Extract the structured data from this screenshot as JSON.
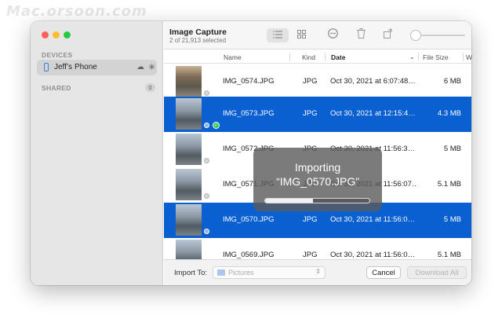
{
  "watermark": "Mac.orsoon.com",
  "sidebar": {
    "devices_heading": "DEVICES",
    "device_name": "Jeff’s Phone",
    "shared_heading": "SHARED",
    "shared_count": "0"
  },
  "toolbar": {
    "title": "Image Capture",
    "subtitle": "2 of 21,913 selected",
    "icons": [
      "list-view-icon",
      "grid-view-icon",
      "more-icon",
      "trash-icon",
      "rotate-icon",
      "thumbnail-size-slider"
    ]
  },
  "table": {
    "headers": {
      "name": "Name",
      "kind": "Kind",
      "date": "Date",
      "size": "File Size",
      "extra": "W"
    },
    "rows": [
      {
        "name": "IMG_0574.JPG",
        "kind": "JPG",
        "date": "Oct 30, 2021 at 6:07:48…",
        "size": "6 MB",
        "selected": false
      },
      {
        "name": "IMG_0573.JPG",
        "kind": "JPG",
        "date": "Oct 30, 2021 at 12:15:4…",
        "size": "4.3 MB",
        "selected": true
      },
      {
        "name": "IMG_0572.JPG",
        "kind": "JPG",
        "date": "Oct 30, 2021 at 11:56:3…",
        "size": "5 MB",
        "selected": false
      },
      {
        "name": "IMG_0571.JPG",
        "kind": "JPG",
        "date": "Oct 30, 2021 at 11:56:07…",
        "size": "5.1 MB",
        "selected": false
      },
      {
        "name": "IMG_0570.JPG",
        "kind": "JPG",
        "date": "Oct 30, 2021 at 11:56:0…",
        "size": "5 MB",
        "selected": true
      },
      {
        "name": "IMG_0569.JPG",
        "kind": "JPG",
        "date": "Oct 30, 2021 at 11:56:0…",
        "size": "5.1 MB",
        "selected": false
      }
    ]
  },
  "footer": {
    "import_label": "Import To:",
    "destination": "Pictures",
    "cancel_label": "Cancel",
    "download_label": "Download All"
  },
  "progress": {
    "title": "Importing",
    "file": "“IMG_0570.JPG”",
    "fraction": 0.46
  },
  "colors": {
    "selection": "#0a5fd1",
    "close": "#fe5f57",
    "minimize": "#febc2e",
    "maximize": "#28c840"
  }
}
